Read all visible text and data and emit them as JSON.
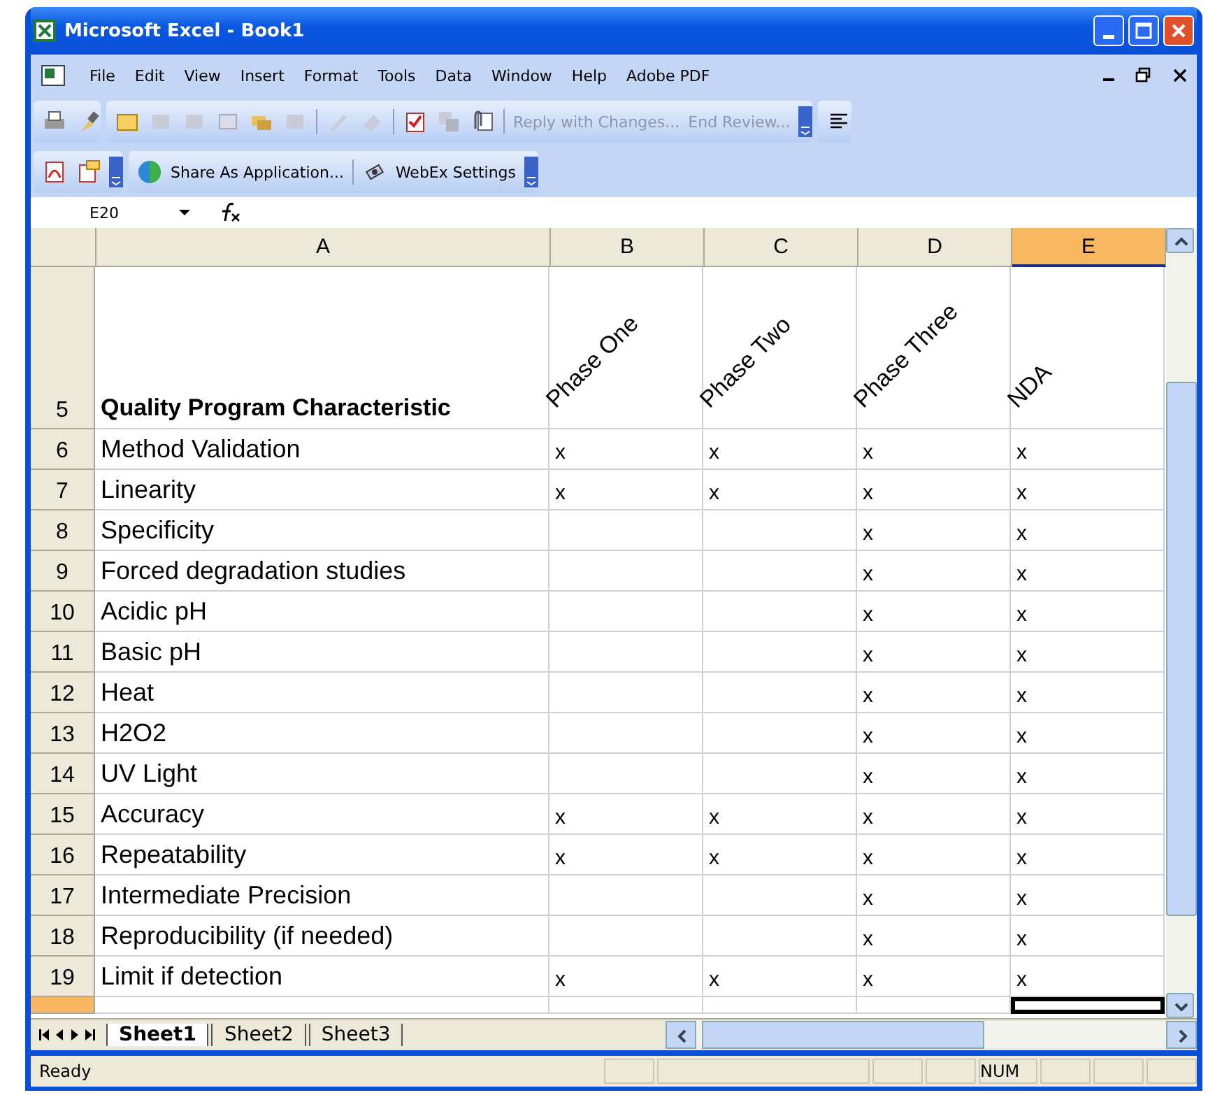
{
  "window": {
    "title": "Microsoft Excel - Book1"
  },
  "menu": [
    "File",
    "Edit",
    "View",
    "Insert",
    "Format",
    "Tools",
    "Data",
    "Window",
    "Help",
    "Adobe PDF"
  ],
  "review_toolbar": {
    "reply": "Reply with Changes...",
    "end": "End Review..."
  },
  "webex_toolbar": {
    "share": "Share As Application...",
    "settings": "WebEx Settings"
  },
  "formula_bar": {
    "name_box": "E20"
  },
  "columns": [
    {
      "label": "A",
      "selected": false
    },
    {
      "label": "B",
      "selected": false
    },
    {
      "label": "C",
      "selected": false
    },
    {
      "label": "D",
      "selected": false
    },
    {
      "label": "E",
      "selected": true
    }
  ],
  "header_row": {
    "number": "5",
    "title": "Quality Program Characteristic",
    "phases": [
      "Phase One",
      "Phase Two",
      "Phase Three",
      "NDA"
    ]
  },
  "rows": [
    {
      "number": "6",
      "label": "Method Validation",
      "b": "x",
      "c": "x",
      "d": "x",
      "e": "x"
    },
    {
      "number": "7",
      "label": "Linearity",
      "b": "x",
      "c": "x",
      "d": "x",
      "e": "x"
    },
    {
      "number": "8",
      "label": "Specificity",
      "d": "x",
      "e": "x"
    },
    {
      "number": "9",
      "label": "Forced degradation studies",
      "d": "x",
      "e": "x"
    },
    {
      "number": "10",
      "label": "Acidic pH",
      "d": "x",
      "e": "x"
    },
    {
      "number": "11",
      "label": "Basic pH",
      "d": "x",
      "e": "x"
    },
    {
      "number": "12",
      "label": "Heat",
      "d": "x",
      "e": "x"
    },
    {
      "number": "13",
      "label": "H2O2",
      "d": "x",
      "e": "x"
    },
    {
      "number": "14",
      "label": "UV Light",
      "d": "x",
      "e": "x"
    },
    {
      "number": "15",
      "label": "Accuracy",
      "b": "x",
      "c": "x",
      "d": "x",
      "e": "x"
    },
    {
      "number": "16",
      "label": "Repeatability",
      "b": "x",
      "c": "x",
      "d": "x",
      "e": "x"
    },
    {
      "number": "17",
      "label": "Intermediate Precision",
      "d": "x",
      "e": "x"
    },
    {
      "number": "18",
      "label": "Reproducibility (if needed)",
      "d": "x",
      "e": "x"
    },
    {
      "number": "19",
      "label": "Limit if detection",
      "b": "x",
      "c": "x",
      "d": "x",
      "e": "x"
    }
  ],
  "sheets": [
    {
      "label": "Sheet1",
      "selected": true
    },
    {
      "label": "Sheet2",
      "selected": false
    },
    {
      "label": "Sheet3",
      "selected": false
    }
  ],
  "status_bar": {
    "text": "Ready",
    "num": "NUM"
  }
}
